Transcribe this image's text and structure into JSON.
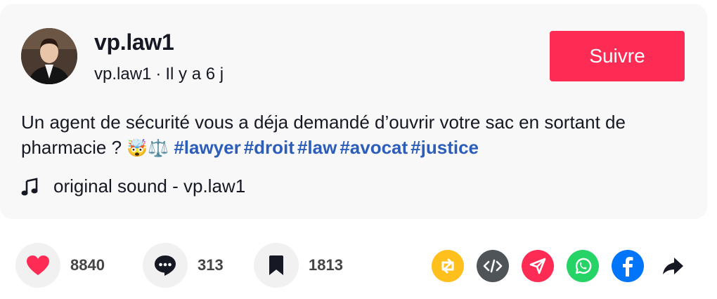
{
  "post": {
    "username": "vp.law1",
    "handle": "vp.law1",
    "separator": "·",
    "time_ago": "Il y a 6 j",
    "follow_label": "Suivre",
    "description": "Un agent de sécurité vous a déja demandé d’ouvrir votre sac en sortant de pharmacie ?",
    "emojis": "🤯⚖️",
    "hashtags": [
      "#lawyer",
      "#droit",
      "#law",
      "#avocat",
      "#justice"
    ],
    "sound": "original sound - vp.law1"
  },
  "stats": {
    "likes": "8840",
    "comments": "313",
    "saves": "1813"
  },
  "share_icons": [
    "repost-icon",
    "embed-icon",
    "send-icon",
    "whatsapp-icon",
    "facebook-icon",
    "share-arrow-icon"
  ],
  "colors": {
    "follow": "#fe2c55",
    "hashtag": "#2b5db9",
    "like": "#fe2c55",
    "repost": "#ffc01e",
    "embed": "#4f5459",
    "send": "#fe2c55",
    "whatsapp": "#25d366",
    "facebook": "#0075fa"
  }
}
